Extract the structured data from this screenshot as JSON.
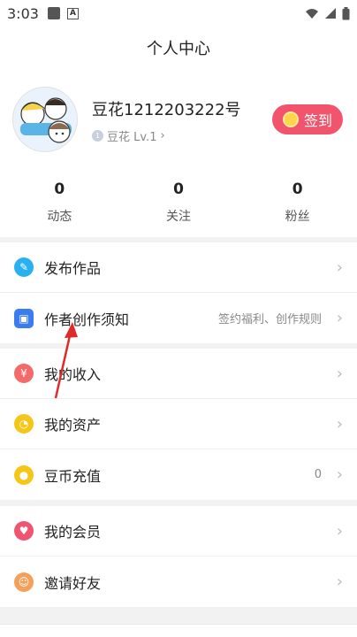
{
  "status_bar": {
    "time": "3:03",
    "a_icon": "A"
  },
  "header": {
    "title": "个人中心"
  },
  "profile": {
    "username": "豆花1212203222号",
    "level": "豆花 Lv.1",
    "level_chevron": "›",
    "checkin_label": "签到"
  },
  "stats": [
    {
      "num": "0",
      "label": "动态"
    },
    {
      "num": "0",
      "label": "关注"
    },
    {
      "num": "0",
      "label": "粉丝"
    }
  ],
  "menu": {
    "group1": [
      {
        "label": "发布作品",
        "hint": "",
        "icon": "pencil-icon",
        "color": "#29b0f0",
        "glyph": "✎"
      },
      {
        "label": "作者创作须知",
        "hint": "签约福利、创作规则",
        "icon": "book-icon",
        "color": "#3b7df0",
        "glyph": "▣"
      }
    ],
    "group2": [
      {
        "label": "我的收入",
        "hint": "",
        "icon": "yen-icon",
        "color": "#f36a6a",
        "glyph": "¥"
      },
      {
        "label": "我的资产",
        "hint": "",
        "icon": "asset-icon",
        "color": "#f5c518",
        "glyph": "◔"
      },
      {
        "label": "豆币充值",
        "hint": "0",
        "icon": "coin-icon",
        "color": "#f5c518",
        "glyph": "●"
      }
    ],
    "group3": [
      {
        "label": "我的会员",
        "hint": "",
        "icon": "vip-heart-icon",
        "color": "#f0546e",
        "glyph": "♥"
      },
      {
        "label": "邀请好友",
        "hint": "",
        "icon": "friend-icon",
        "color": "#f5a05a",
        "glyph": "☺"
      }
    ],
    "chevron": "›"
  },
  "colors": {
    "accent": "#f2546e",
    "annotation_arrow": "#e02a2a"
  }
}
